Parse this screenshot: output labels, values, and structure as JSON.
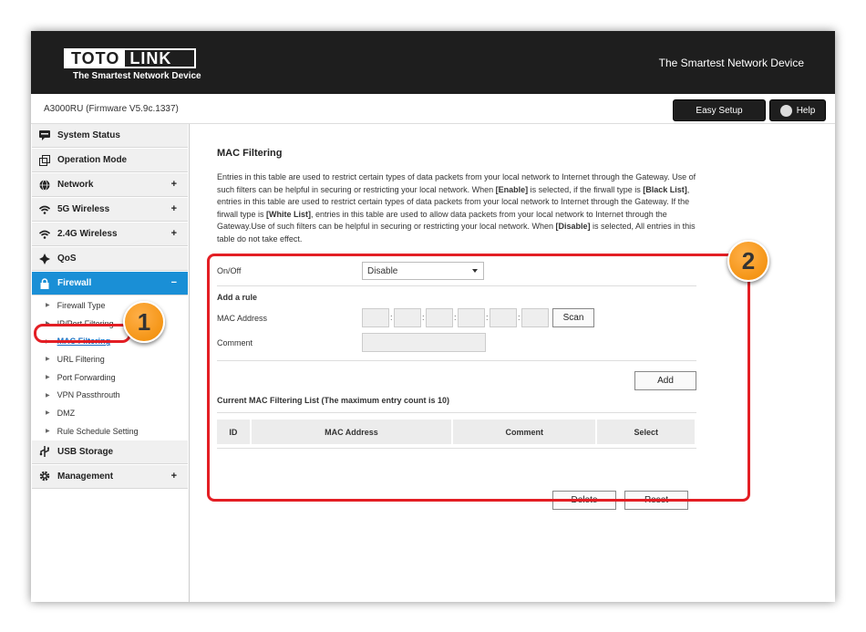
{
  "header": {
    "logo_left": "TOTO",
    "logo_right": "LINK",
    "logo_sub": "The Smartest Network Device",
    "tagline": "The Smartest Network Device"
  },
  "subbar": {
    "firmware": "A3000RU (Firmware V5.9c.1337)",
    "easy_setup": "Easy Setup",
    "help": "Help"
  },
  "sidebar": {
    "items": [
      {
        "label": "System Status",
        "icon": "chat-icon"
      },
      {
        "label": "Operation Mode",
        "icon": "mode-icon"
      },
      {
        "label": "Network",
        "icon": "globe-icon",
        "plus": "+"
      },
      {
        "label": "5G Wireless",
        "icon": "wifi-icon",
        "plus": "+"
      },
      {
        "label": "2.4G Wireless",
        "icon": "wifi-icon",
        "plus": "+"
      },
      {
        "label": "QoS",
        "icon": "qos-icon"
      },
      {
        "label": "Firewall",
        "icon": "lock-icon",
        "plus": "−"
      },
      {
        "label": "USB Storage",
        "icon": "usb-icon"
      },
      {
        "label": "Management",
        "icon": "gear-icon",
        "plus": "+"
      }
    ],
    "firewall_sub": [
      "Firewall Type",
      "IP/Port Filtering",
      "MAC Filtering",
      "URL Filtering",
      "Port Forwarding",
      "VPN Passthrouth",
      "DMZ",
      "Rule Schedule Setting"
    ]
  },
  "main": {
    "title": "MAC Filtering",
    "description": [
      {
        "t": "Entries in this table are used to restrict certain types of data packets from your local network to Internet through the Gateway. Use of such filters can be helpful in securing or restricting your local network. When "
      },
      {
        "b": "[Enable]"
      },
      {
        "t": " is selected, if the firwall type is "
      },
      {
        "b": "[Black List]"
      },
      {
        "t": ", entries in this table are used to restrict certain types of data packets from your local network to Internet through the Gateway. If the firwall type is "
      },
      {
        "b": "[White List]"
      },
      {
        "t": ", entries in this table are used to allow data packets from your local network to Internet through the Gateway.Use of such filters can be helpful in securing or restricting your local network. When "
      },
      {
        "b": "[Disable]"
      },
      {
        "t": " is selected, All entries in this table do not take effect."
      }
    ]
  },
  "form": {
    "onoff_label": "On/Off",
    "onoff_value": "Disable",
    "add_rule": "Add a rule",
    "mac_label": "MAC Address",
    "mac_octets": [
      "",
      "",
      "",
      "",
      "",
      ""
    ],
    "scan": "Scan",
    "comment_label": "Comment",
    "comment_value": "",
    "add": "Add",
    "list_title": "Current MAC Filtering List  (The maximum entry count is 10)",
    "columns": [
      "ID",
      "MAC Address",
      "Comment",
      "Select"
    ],
    "delete": "Delete",
    "reset": "Reset"
  },
  "annotations": {
    "badge1": "1",
    "badge2": "2",
    "color": "#e31e24"
  }
}
